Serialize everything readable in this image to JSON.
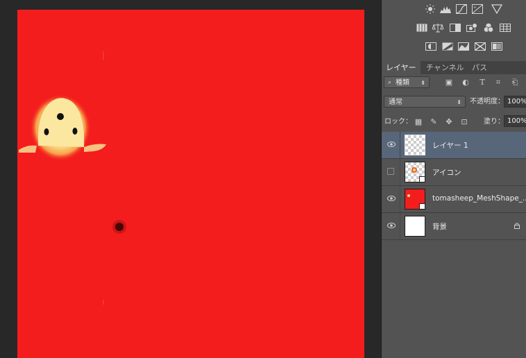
{
  "tabs": [
    {
      "label": "レイヤー",
      "active": true
    },
    {
      "label": "チャンネル",
      "active": false
    },
    {
      "label": "パス",
      "active": false
    }
  ],
  "filter": {
    "label": "種類",
    "icon": "search-icon"
  },
  "blend": {
    "mode": "通常",
    "opacity_label": "不透明度：",
    "opacity_value": "100%"
  },
  "lock": {
    "label": "ロック：",
    "fill_label": "塗り：",
    "fill_value": "100%"
  },
  "layers": [
    {
      "name": "レイヤー 1",
      "visible": true,
      "selected": true,
      "thumb": "transparent"
    },
    {
      "name": "アイコン",
      "visible": false,
      "selected": false,
      "thumb": "icon-smart-object"
    },
    {
      "name": "tomasheep_MeshShape_...",
      "visible": true,
      "selected": false,
      "thumb": "red-smart-object"
    },
    {
      "name": "背景",
      "visible": true,
      "selected": false,
      "thumb": "white",
      "locked": true
    }
  ],
  "colors": {
    "canvas": "#f41d1d",
    "panel": "#535353",
    "selected_layer": "#58667a",
    "workspace": "#282828"
  },
  "adjustment_icons": [
    "brightness-icon",
    "levels-icon",
    "curves-icon",
    "exposure-icon",
    "triangle-icon",
    "vibrance-icon",
    "balance-icon",
    "bw-icon",
    "photo-filter-icon",
    "channel-mixer-icon",
    "color-lookup-icon",
    "invert-icon",
    "posterize-icon",
    "threshold-icon",
    "selective-color-icon",
    "gradient-map-icon"
  ]
}
